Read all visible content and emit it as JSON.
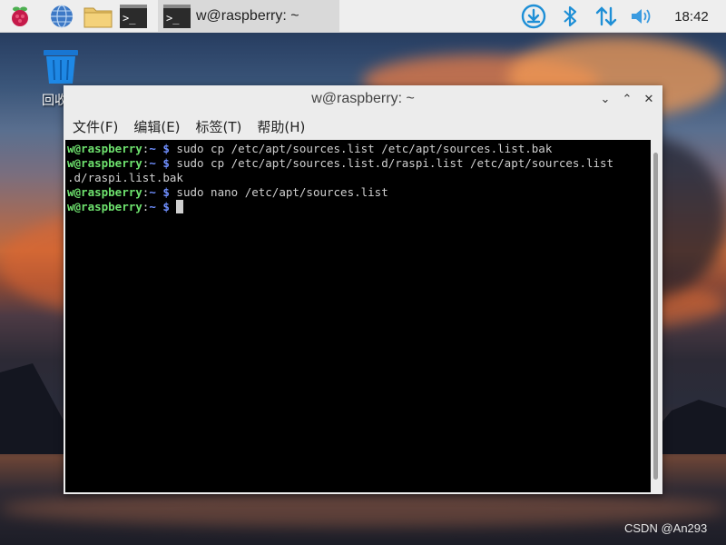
{
  "taskbar": {
    "launchers": [
      {
        "icon": "raspberry-icon"
      },
      {
        "icon": "globe-icon"
      },
      {
        "icon": "folder-icon"
      },
      {
        "icon": "terminal-icon"
      }
    ],
    "task": {
      "icon": "terminal-icon",
      "label": "w@raspberry: ~"
    },
    "tray": [
      "download-icon",
      "bluetooth-icon",
      "network-arrows-icon",
      "volume-icon"
    ],
    "clock": "18:42"
  },
  "desktop": {
    "trash_label": "回收"
  },
  "window": {
    "title": "w@raspberry: ~",
    "menu": [
      "文件(F)",
      "编辑(E)",
      "标签(T)",
      "帮助(H)"
    ],
    "controls": {
      "minimize": "⌄",
      "maximize": "⌃",
      "close": "✕"
    }
  },
  "terminal": {
    "prompt_user": "w@raspberry",
    "prompt_sep": ":",
    "prompt_path": "~ $",
    "commands": [
      " sudo cp /etc/apt/sources.list /etc/apt/sources.list.bak",
      " sudo cp /etc/apt/sources.list.d/raspi.list /etc/apt/sources.list",
      " sudo nano /etc/apt/sources.list"
    ],
    "wrap_line": ".d/raspi.list.bak"
  },
  "watermark": "CSDN @An293",
  "colors": {
    "prompt_user": "#6ee26e",
    "prompt_path": "#6f8fff",
    "terminal_bg": "#000000"
  }
}
